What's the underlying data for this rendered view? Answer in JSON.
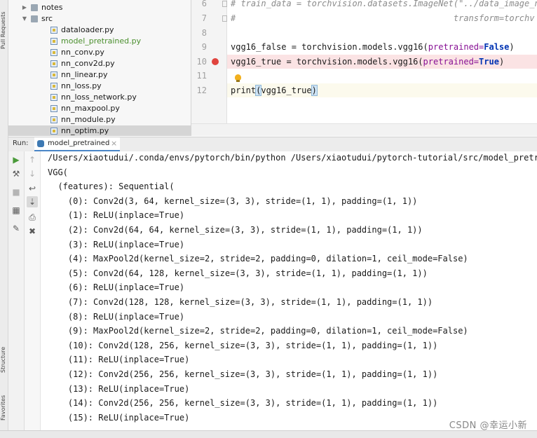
{
  "left_strip": {
    "pull_requests": "Pull Requests",
    "structure": "Structure",
    "favorites": "Favorites"
  },
  "project_tree": [
    {
      "label": "notes",
      "kind": "folder",
      "expanded": false
    },
    {
      "label": "src",
      "kind": "folder",
      "expanded": true
    },
    {
      "label": "dataloader.py",
      "kind": "file"
    },
    {
      "label": "model_pretrained.py",
      "kind": "file",
      "color": "#4b8f2e"
    },
    {
      "label": "nn_conv.py",
      "kind": "file"
    },
    {
      "label": "nn_conv2d.py",
      "kind": "file"
    },
    {
      "label": "nn_linear.py",
      "kind": "file"
    },
    {
      "label": "nn_loss.py",
      "kind": "file"
    },
    {
      "label": "nn_loss_network.py",
      "kind": "file"
    },
    {
      "label": "nn_maxpool.py",
      "kind": "file"
    },
    {
      "label": "nn_module.py",
      "kind": "file"
    },
    {
      "label": "nn_optim.py",
      "kind": "file",
      "selected": true
    }
  ],
  "editor": {
    "line_numbers": [
      "6",
      "7",
      "8",
      "9",
      "10",
      "11",
      "12"
    ],
    "line6_comment": "# train_data = torchvision.datasets.ImageNet(\"../data_image_n",
    "line7_comment": "#                                           transform=torchv",
    "line9": {
      "lhs": "vgg16_false = torchvision.models.vgg16(",
      "param": "pretrained=",
      "value": "False",
      "close": ")"
    },
    "line10": {
      "lhs": "vgg16_true = torchvision.models.vgg16(",
      "param": "pretrained=",
      "value": "True",
      "close": ")"
    },
    "line12": {
      "fn": "print",
      "open": "(",
      "arg": "vgg16_true",
      "close": ")"
    },
    "breakpoint_color": "#e0443e",
    "bulb_icon": "lightbulb-icon"
  },
  "run": {
    "label": "Run:",
    "tab_name": "model_pretrained",
    "tab_close": "×"
  },
  "console_lines": [
    "/Users/xiaotudui/.conda/envs/pytorch/bin/python /Users/xiaotudui/pytorch-tutorial/src/model_pretra",
    "VGG(",
    "  (features): Sequential(",
    "    (0): Conv2d(3, 64, kernel_size=(3, 3), stride=(1, 1), padding=(1, 1))",
    "    (1): ReLU(inplace=True)",
    "    (2): Conv2d(64, 64, kernel_size=(3, 3), stride=(1, 1), padding=(1, 1))",
    "    (3): ReLU(inplace=True)",
    "    (4): MaxPool2d(kernel_size=2, stride=2, padding=0, dilation=1, ceil_mode=False)",
    "    (5): Conv2d(64, 128, kernel_size=(3, 3), stride=(1, 1), padding=(1, 1))",
    "    (6): ReLU(inplace=True)",
    "    (7): Conv2d(128, 128, kernel_size=(3, 3), stride=(1, 1), padding=(1, 1))",
    "    (8): ReLU(inplace=True)",
    "    (9): MaxPool2d(kernel_size=2, stride=2, padding=0, dilation=1, ceil_mode=False)",
    "    (10): Conv2d(128, 256, kernel_size=(3, 3), stride=(1, 1), padding=(1, 1))",
    "    (11): ReLU(inplace=True)",
    "    (12): Conv2d(256, 256, kernel_size=(3, 3), stride=(1, 1), padding=(1, 1))",
    "    (13): ReLU(inplace=True)",
    "    (14): Conv2d(256, 256, kernel_size=(3, 3), stride=(1, 1), padding=(1, 1))",
    "    (15): ReLU(inplace=True)"
  ],
  "watermark": "CSDN @幸运小新"
}
